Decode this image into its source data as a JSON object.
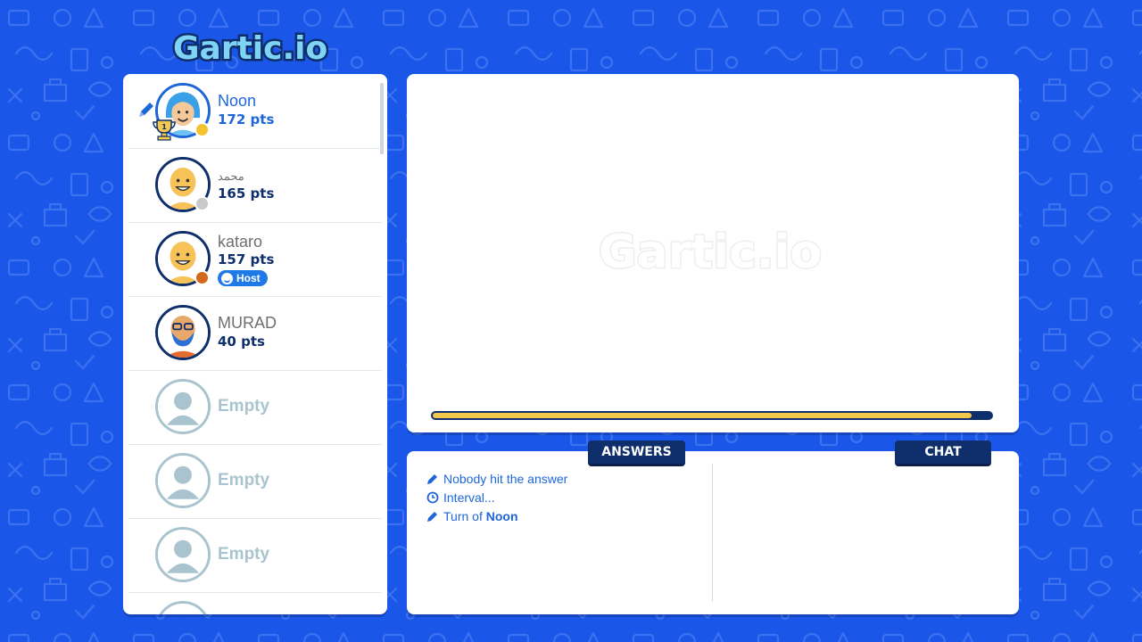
{
  "logo": {
    "text": "Gartic.io"
  },
  "players": [
    {
      "name": "Noon",
      "points": "172 pts",
      "active": true,
      "drawing": true,
      "rank": "1",
      "status_color": "#f4c430",
      "avatar": "girl"
    },
    {
      "name": "محمد",
      "points": "165 pts",
      "status_color": "#c9c9c9",
      "avatar": "bald"
    },
    {
      "name": "kataro",
      "points": "157 pts",
      "status_color": "#d2691e",
      "avatar": "bald",
      "badge": "Host"
    },
    {
      "name": "MURAD",
      "points": "40 pts",
      "avatar": "bearded"
    },
    {
      "empty_label": "Empty"
    },
    {
      "empty_label": "Empty"
    },
    {
      "empty_label": "Empty"
    }
  ],
  "canvas": {
    "watermark": "Gartic.io",
    "timer_fraction": 0.965
  },
  "tabs": {
    "answers": "ANSWERS",
    "chat": "CHAT"
  },
  "answers": [
    {
      "icon": "pencil-icon",
      "text": "Nobody hit the answer"
    },
    {
      "icon": "clock-icon",
      "text": "Interval..."
    },
    {
      "icon": "pencil-icon",
      "prefix": "Turn of ",
      "bold": "Noon"
    }
  ],
  "colors": {
    "background": "#1a56e8",
    "accent_blue": "#1d66d9",
    "navy": "#0e2e6c",
    "timer_yellow": "#f2c94c"
  }
}
